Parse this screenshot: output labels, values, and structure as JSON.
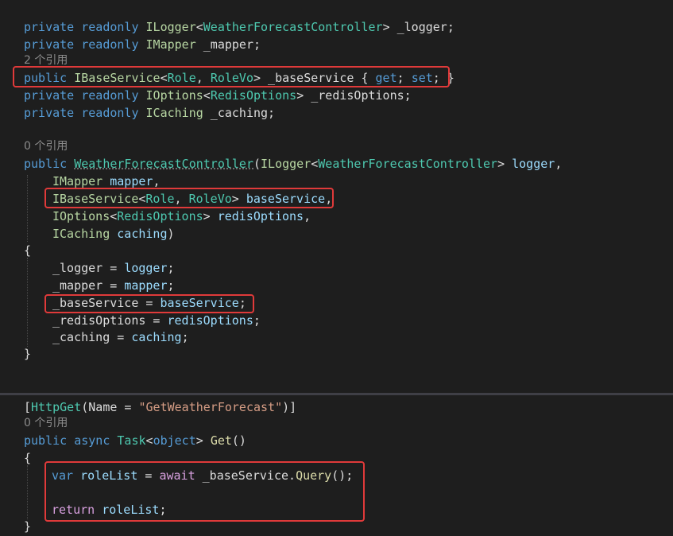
{
  "top": {
    "l1": {
      "kw": "private readonly ",
      "t": "ILogger",
      "lt": "<",
      "cls": "WeatherForecastController",
      "gt": ">",
      "name": " _logger;"
    },
    "l2": {
      "kw": "private readonly ",
      "t": "IMapper",
      "name": " _mapper;"
    },
    "l3_ref": "2 个引用",
    "l4": {
      "kw": "public ",
      "t": "IBaseService",
      "lt": "<",
      "a": "Role",
      "comma": ", ",
      "b": "RoleVo",
      "gt": ">",
      "name": " _baseService { ",
      "get": "get",
      "semi1": "; ",
      "set": "set",
      "semi2": "; }"
    },
    "l5": {
      "kw": "private readonly ",
      "t": "IOptions",
      "lt": "<",
      "cls": "RedisOptions",
      "gt": ">",
      "name": " _redisOptions;"
    },
    "l6": {
      "kw": "private readonly ",
      "t": "ICaching",
      "name": " _caching;"
    },
    "l8_ref": "0 个引用",
    "l9": {
      "kw": "public ",
      "cls": "WeatherForecastController",
      "p1": "(",
      "t": "ILogger",
      "lt": "<",
      "cls2": "WeatherForecastController",
      "gt": ">",
      "var": " logger",
      "p2": ","
    },
    "l10": {
      "t": "IMapper",
      "var": " mapper",
      "p": ","
    },
    "l11": {
      "t": "IBaseService",
      "lt": "<",
      "a": "Role",
      "comma": ", ",
      "b": "RoleVo",
      "gt": ">",
      "var": " baseService",
      "p": ","
    },
    "l12": {
      "t": "IOptions",
      "lt": "<",
      "cls": "RedisOptions",
      "gt": ">",
      "var": " redisOptions",
      "p": ","
    },
    "l13": {
      "t": "ICaching",
      "var": " caching",
      "p": ")"
    },
    "l14": "{",
    "l15": {
      "f": "_logger",
      "eq": " = ",
      "v": "logger",
      "p": ";"
    },
    "l16": {
      "f": "_mapper",
      "eq": " = ",
      "v": "mapper",
      "p": ";"
    },
    "l17": {
      "f": "_baseService",
      "eq": " = ",
      "v": "baseService",
      "p": ";"
    },
    "l18": {
      "f": "_redisOptions",
      "eq": " = ",
      "v": "redisOptions",
      "p": ";"
    },
    "l19": {
      "f": "_caching",
      "eq": " = ",
      "v": "caching",
      "p": ";"
    },
    "l20": "}"
  },
  "bottom": {
    "l1": {
      "o": "[",
      "attr": "HttpGet",
      "p1": "(Name = ",
      "str": "\"GetWeatherForecast\"",
      "p2": ")]"
    },
    "l2_ref": "0 个引用",
    "l3": {
      "kw1": "public ",
      "kw2": "async ",
      "cls": "Task",
      "lt": "<",
      "kw3": "object",
      "gt": ">",
      "sp": " ",
      "meth": "Get",
      "p": "()"
    },
    "l4": "{",
    "l5": {
      "kw": "var ",
      "v": "roleList",
      "eq": " = ",
      "await": "await ",
      "f": "_baseService",
      "dot": ".",
      "meth": "Query",
      "p": "();"
    },
    "l6": {
      "ret": "return ",
      "v": "roleList",
      "p": ";"
    },
    "l7": "}"
  }
}
